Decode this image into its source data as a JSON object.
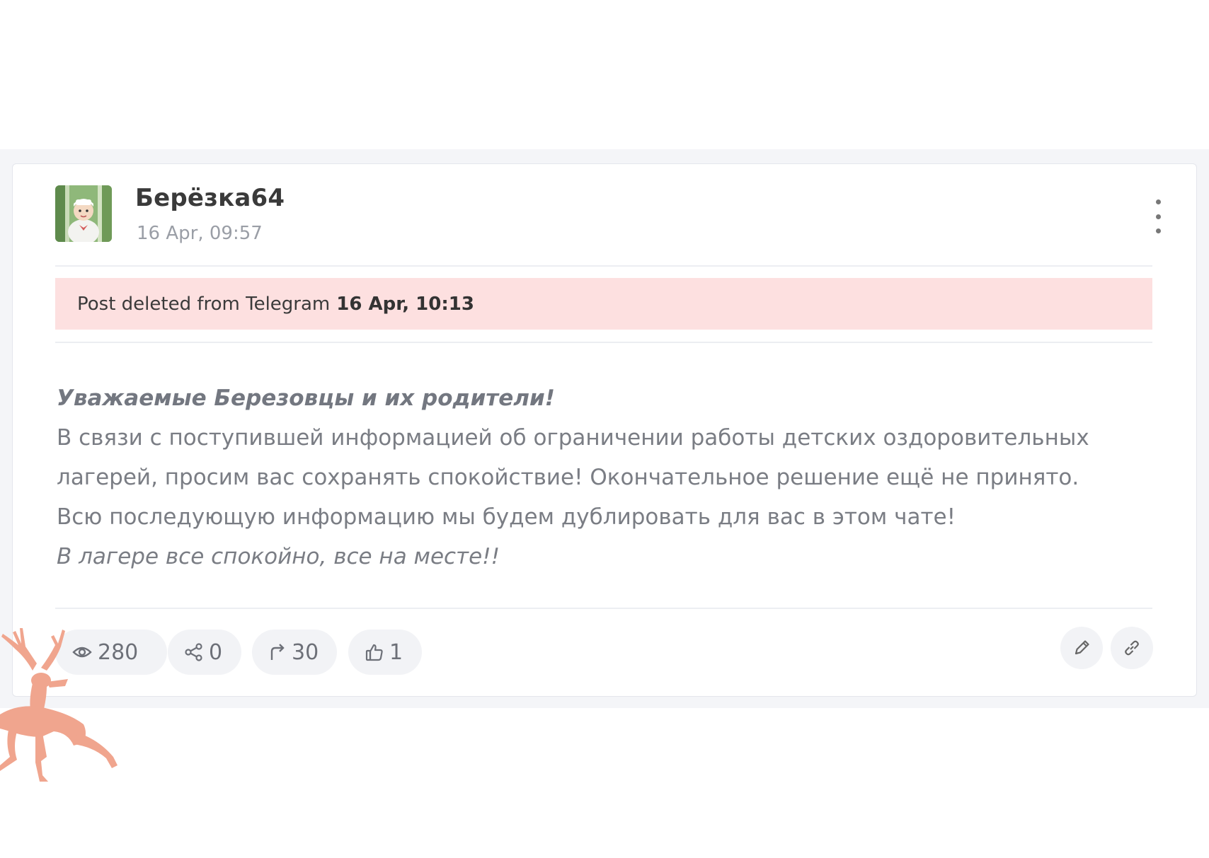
{
  "post": {
    "author": "Берёзка64",
    "timestamp": "16 Apr, 09:57",
    "deleted_notice": {
      "text": "Post deleted from Telegram",
      "time": "16 Apr, 10:13"
    },
    "message": {
      "greeting": "Уважаемые Березовцы и их родители!",
      "line1": "В связи с поступившей информацией об ограничении работы детских оздоровительных",
      "line2": "лагерей, просим вас сохранять спокойствие! Окончательное решение ещё не принято.",
      "line3": "Всю последующую информацию мы будем дублировать для вас в этом чате!",
      "closing": "В лагере все спокойно, все на месте!!"
    },
    "stats": {
      "views": "280",
      "shares": "0",
      "forwards": "30",
      "likes": "1"
    }
  },
  "icons": {
    "menu": "vertical-dots-icon",
    "views": "eye-icon",
    "shares": "share-icon",
    "forwards": "forward-arrow-icon",
    "likes": "thumbs-up-icon",
    "edit": "pencil-icon",
    "link": "link-icon"
  },
  "colors": {
    "deleted_banner_bg": "#fde0e0",
    "deer_watermark": "#f0a58e"
  }
}
